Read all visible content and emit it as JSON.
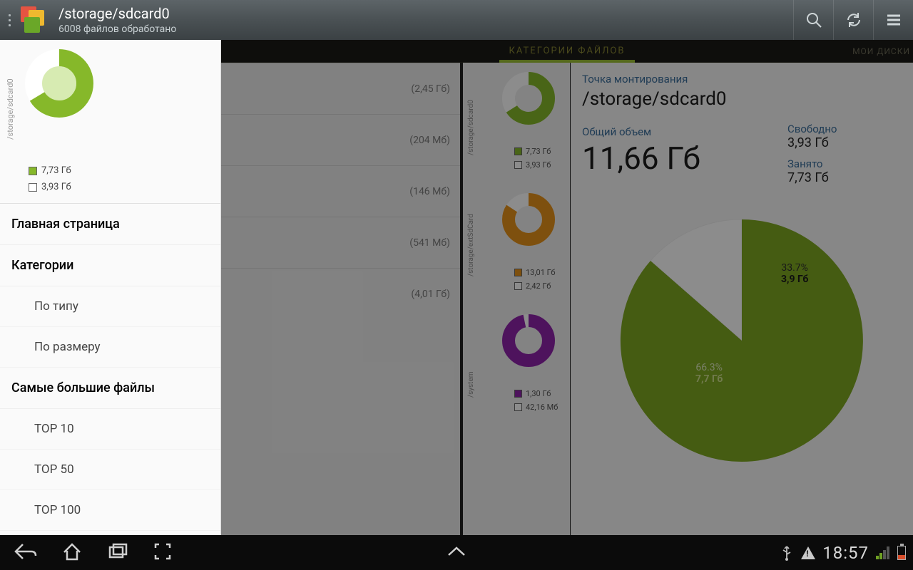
{
  "header": {
    "path": "/storage/sdcard0",
    "status": "6008 файлов обработано"
  },
  "tabs": {
    "active": "КАТЕГОРИИ ФАЙЛОВ",
    "right": "МОИ ДИСКИ"
  },
  "sidebar": {
    "disk_label": "/storage/sdcard0",
    "used": "7,73 Гб",
    "free": "3,93 Гб",
    "home": "Главная страница",
    "categories": "Категории",
    "by_type": "По типу",
    "by_size": "По размеру",
    "largest": "Самые большие файлы",
    "top10": "TOP 10",
    "top50": "TOP 50",
    "top100": "TOP 100"
  },
  "mid_sizes": [
    "(2,45 Гб)",
    "(204 Мб)",
    "(146 Мб)",
    "(541 Мб)",
    "(4,01 Гб)"
  ],
  "donuts": [
    {
      "label": "/storage/sdcard0",
      "used": "7,73 Гб",
      "free": "3,93 Гб",
      "used_pct": 66.3,
      "color": "#86b82a"
    },
    {
      "label": "/storage/extSdCard",
      "used": "13,01 Гб",
      "free": "2,42 Гб",
      "used_pct": 84.3,
      "color": "#e6921a"
    },
    {
      "label": "/system",
      "used": "1,30 Гб",
      "free": "42,16 Мб",
      "used_pct": 96.9,
      "color": "#8e24aa"
    }
  ],
  "detail": {
    "mount_label": "Точка монтирования",
    "mount_path": "/storage/sdcard0",
    "total_label": "Общий объем",
    "total_val": "11,66 Гб",
    "free_label": "Свободно",
    "free_val": "3,93 Гб",
    "used_label": "Занято",
    "used_val": "7,73 Гб"
  },
  "chart_data": {
    "type": "pie",
    "title": "",
    "slices": [
      {
        "name": "Занято",
        "pct": 66.3,
        "label": "7,7 Гб",
        "color": "#7ea821"
      },
      {
        "name": "Свободно",
        "pct": 33.7,
        "label": "3,9 Гб",
        "color": "#ffffff"
      }
    ]
  },
  "statusbar": {
    "time": "18:57"
  }
}
